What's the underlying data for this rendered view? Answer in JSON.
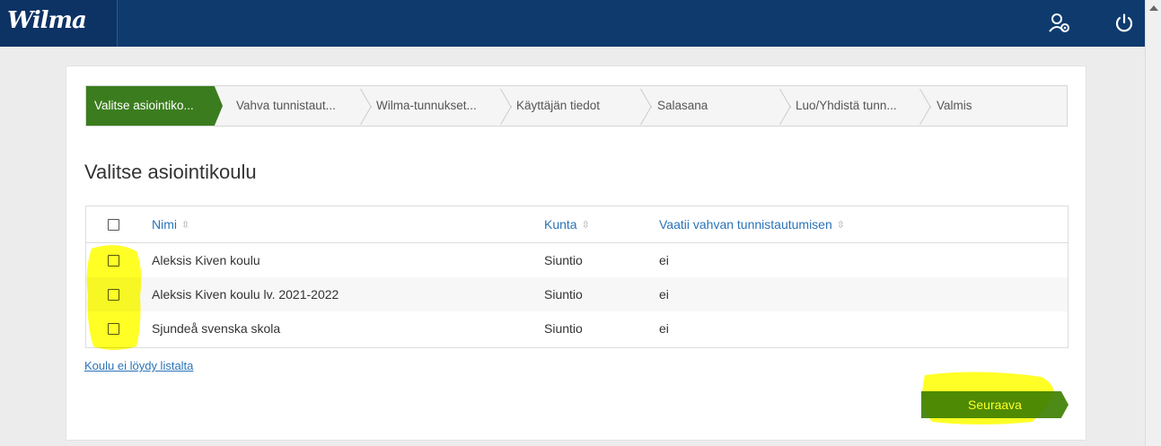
{
  "header": {
    "logo": "Wilma",
    "user_icon": "user-settings-icon",
    "power_icon": "power-icon"
  },
  "wizard": {
    "steps": [
      {
        "label": "Valitse asiointiko..."
      },
      {
        "label": "Vahva tunnistaut..."
      },
      {
        "label": "Wilma-tunnukset..."
      },
      {
        "label": "Käyttäjän tiedot"
      },
      {
        "label": "Salasana"
      },
      {
        "label": "Luo/Yhdistä tunn..."
      },
      {
        "label": "Valmis"
      }
    ]
  },
  "page": {
    "title": "Valitse asiointikoulu"
  },
  "table": {
    "columns": [
      "Nimi",
      "Kunta",
      "Vaatii vahvan tunnistautumisen"
    ],
    "sort_glyph": "⇳",
    "rows": [
      {
        "name": "Aleksis Kiven koulu",
        "kunta": "Siuntio",
        "vaatii": "ei"
      },
      {
        "name": "Aleksis Kiven koulu lv. 2021-2022",
        "kunta": "Siuntio",
        "vaatii": "ei"
      },
      {
        "name": "Sjundeå svenska skola",
        "kunta": "Siuntio",
        "vaatii": "ei"
      }
    ]
  },
  "link": {
    "label": "Koulu ei löydy listalta"
  },
  "next_button": {
    "label": "Seuraava"
  },
  "colors": {
    "topbar": "#0e3a6e",
    "active_step": "#3b7d1e",
    "next_button": "#4e8a17",
    "link": "#2a73b8",
    "highlight": "#ffff00"
  }
}
